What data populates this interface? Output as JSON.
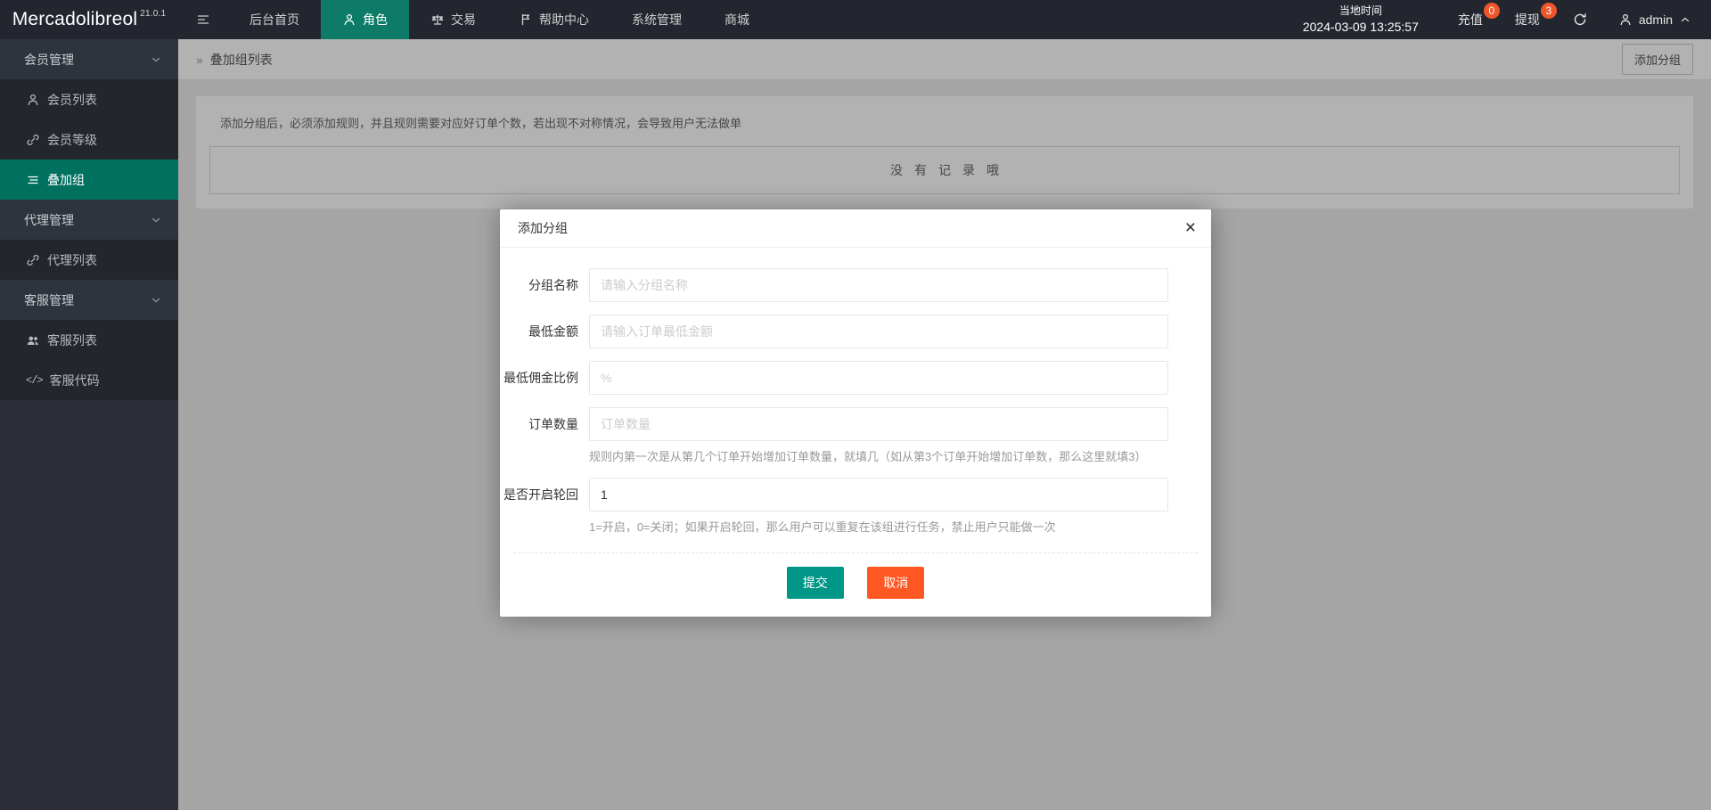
{
  "brand": {
    "name": "Mercadolibreol",
    "version": "21.0.1"
  },
  "topnav": {
    "items": [
      {
        "label": "后台首页",
        "icon": ""
      },
      {
        "label": "角色",
        "icon": "person-icon",
        "active": true
      },
      {
        "label": "交易",
        "icon": "scales-icon"
      },
      {
        "label": "帮助中心",
        "icon": "flag-icon"
      },
      {
        "label": "系统管理",
        "icon": ""
      },
      {
        "label": "商城",
        "icon": ""
      }
    ],
    "local_time_label": "当地时间",
    "local_time_value": "2024-03-09 13:25:57",
    "recharge_label": "充值",
    "recharge_badge": "0",
    "withdraw_label": "提现",
    "withdraw_badge": "3",
    "admin_label": "admin"
  },
  "sidebar": {
    "groups": [
      {
        "label": "会员管理",
        "items": [
          {
            "label": "会员列表",
            "icon": "user-icon"
          },
          {
            "label": "会员等级",
            "icon": "link-icon"
          },
          {
            "label": "叠加组",
            "icon": "list-icon",
            "active": true
          }
        ]
      },
      {
        "label": "代理管理",
        "items": [
          {
            "label": "代理列表",
            "icon": "link-icon"
          }
        ]
      },
      {
        "label": "客服管理",
        "items": [
          {
            "label": "客服列表",
            "icon": "users-icon"
          },
          {
            "label": "客服代码",
            "icon": "code-icon",
            "code_glyph": "</>"
          }
        ]
      }
    ]
  },
  "breadcrumb": {
    "symbol": "»",
    "title": "叠加组列表",
    "add_button_label": "添加分组"
  },
  "content": {
    "alert": "添加分组后，必须添加规则，并且规则需要对应好订单个数，若出现不对称情况，会导致用户无法做单",
    "empty_text": "没有记录哦"
  },
  "modal": {
    "title": "添加分组",
    "close_glyph": "×",
    "rows": [
      {
        "label": "分组名称",
        "placeholder": "请输入分组名称",
        "value": ""
      },
      {
        "label": "最低金额",
        "placeholder": "请输入订单最低金额",
        "value": ""
      },
      {
        "label": "最低佣金比例",
        "placeholder": "%",
        "value": ""
      },
      {
        "label": "订单数量",
        "placeholder": "订单数量",
        "value": "",
        "hint": "规则内第一次是从第几个订单开始增加订单数量，就填几（如从第3个订单开始增加订单数，那么这里就填3）"
      },
      {
        "label": "是否开启轮回",
        "placeholder": "",
        "value": "1",
        "hint": "1=开启，0=关闭；如果开启轮回，那么用户可以重复在该组进行任务，禁止用户只能做一次"
      }
    ],
    "submit_label": "提交",
    "cancel_label": "取消"
  },
  "colors": {
    "navbar_bg": "#23262e",
    "sidebar_bg": "#2b2e36",
    "active_teal": "#0d7b68",
    "sidebar_active_teal": "#00705f",
    "accent_teal": "#009688",
    "warn_orange": "#ff5722",
    "badge_orange": "#f1552a"
  }
}
